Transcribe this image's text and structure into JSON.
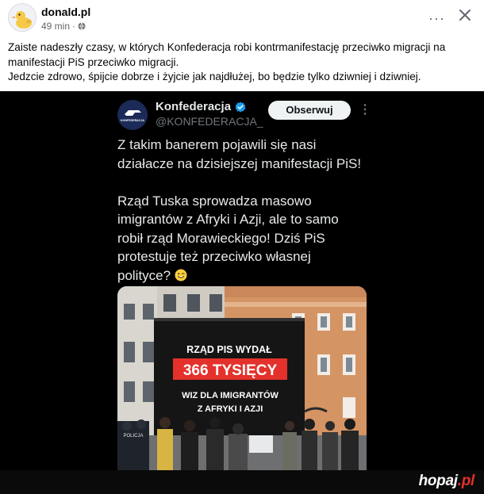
{
  "post": {
    "page_name": "donald.pl",
    "time_ago": "49 min",
    "separator": "·",
    "more_menu": "···",
    "lines": [
      "Zaiste nadeszły czasy, w których Konfederacja robi kontrmanifestację przeciwko migracji na",
      "manifestacji PiS przeciwko migracji.",
      "Jedzcie zdrowo, śpijcie dobrze i żyjcie jak najdłużej, bo będzie tylko dziwniej i dziwniej."
    ]
  },
  "tweet": {
    "account_name": "Konfederacja",
    "handle": "@KONFEDERACJA_",
    "follow_label": "Obserwuj",
    "more_menu": "⋮",
    "lines_p1": [
      "Z takim banerem pojawili się nasi",
      "działacze na dzisiejszej manifestacji PiS!"
    ],
    "lines_p2": [
      "Rząd Tuska sprowadza masowo",
      "imigrantów z Afryki i Azji, ale to samo",
      "robił rząd Morawieckiego! Dziś PiS",
      "protestuje też przeciwko własnej",
      "polityce?"
    ],
    "avatar_text": "KONFEDERACJA"
  },
  "banner": {
    "line1": "RZĄD PIS WYDAŁ",
    "line2": "366 TYSIĘCY",
    "line3": "WIZ DLA IMIGRANTÓW",
    "line4": "Z AFRYKI I AZJI",
    "police_label": "POLICJA"
  },
  "watermark": {
    "brand": "hopaj",
    "suffix": ".pl"
  },
  "colors": {
    "background": "#ffffff",
    "embed_bg": "#000000",
    "follow_bg": "#eff3f4",
    "verified": "#1d9bf0",
    "banner_red": "#e4312b",
    "watermark_red": "#e4312b"
  }
}
